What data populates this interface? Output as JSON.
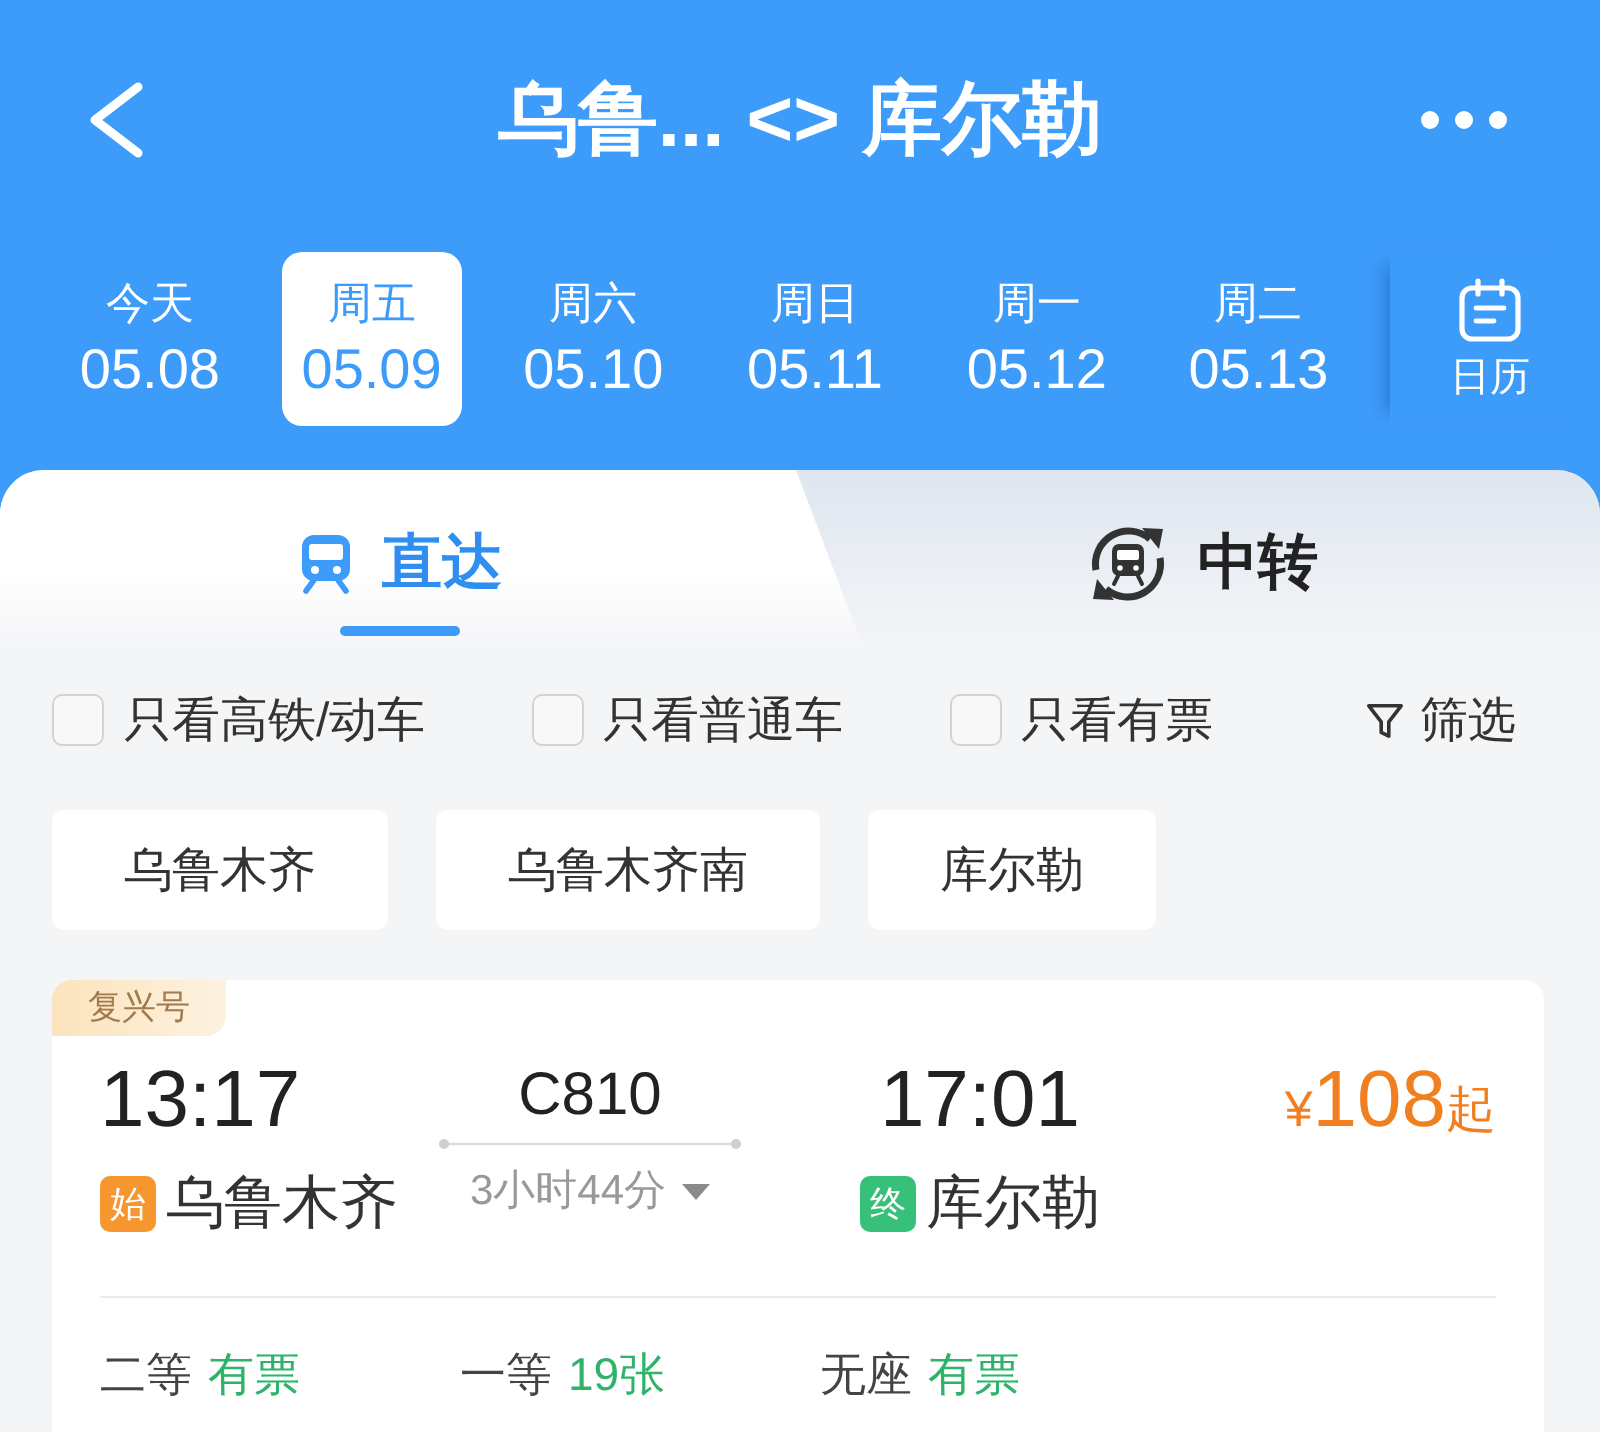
{
  "header": {
    "title": "乌鲁... <> 库尔勒"
  },
  "dates": [
    {
      "weekday": "今天",
      "date": "05.08",
      "selected": false
    },
    {
      "weekday": "周五",
      "date": "05.09",
      "selected": true
    },
    {
      "weekday": "周六",
      "date": "05.10",
      "selected": false
    },
    {
      "weekday": "周日",
      "date": "05.11",
      "selected": false
    },
    {
      "weekday": "周一",
      "date": "05.12",
      "selected": false
    },
    {
      "weekday": "周二",
      "date": "05.13",
      "selected": false
    }
  ],
  "calendar": {
    "label": "日历"
  },
  "tabs": [
    {
      "label": "直达",
      "selected": true
    },
    {
      "label": "中转",
      "selected": false
    }
  ],
  "filters": [
    {
      "label": "只看高铁/动车",
      "checked": false
    },
    {
      "label": "只看普通车",
      "checked": false
    },
    {
      "label": "只看有票",
      "checked": false
    }
  ],
  "filter_button": {
    "label": "筛选"
  },
  "stations": [
    "乌鲁木齐",
    "乌鲁木齐南",
    "库尔勒"
  ],
  "trains": [
    {
      "type": "复兴号",
      "departure_time": "13:17",
      "start_tag": "始",
      "departure_station": "乌鲁木齐",
      "train_number": "C810",
      "duration": "3小时44分",
      "arrival_time": "17:01",
      "end_tag": "终",
      "arrival_station": "库尔勒",
      "price": {
        "currency": "¥",
        "amount": "108",
        "suffix": "起"
      },
      "seats": [
        {
          "class": "二等",
          "availability": "有票"
        },
        {
          "class": "一等",
          "availability": "19张"
        },
        {
          "class": "无座",
          "availability": "有票"
        }
      ]
    }
  ]
}
